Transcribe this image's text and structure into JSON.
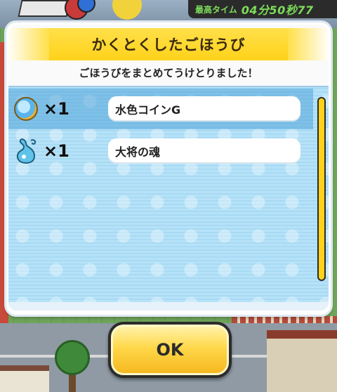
{
  "hud": {
    "label": "最高タイム",
    "time": "04分50秒77"
  },
  "dialog": {
    "title": "かくとくしたごほうび",
    "subtitle": "ごほうびをまとめてうけとりました！",
    "rewards": [
      {
        "icon": "blue-coin-icon",
        "quantity": "×1",
        "name": "水色コインG"
      },
      {
        "icon": "soul-icon",
        "quantity": "×1",
        "name": "大将の魂"
      }
    ]
  },
  "ok_button": {
    "label": "OK"
  },
  "colors": {
    "title_bar": "#ffd21a",
    "list_bg": "#b6e2f8",
    "highlight": "#3c96d2",
    "scrollbar": "#ffd21a"
  }
}
